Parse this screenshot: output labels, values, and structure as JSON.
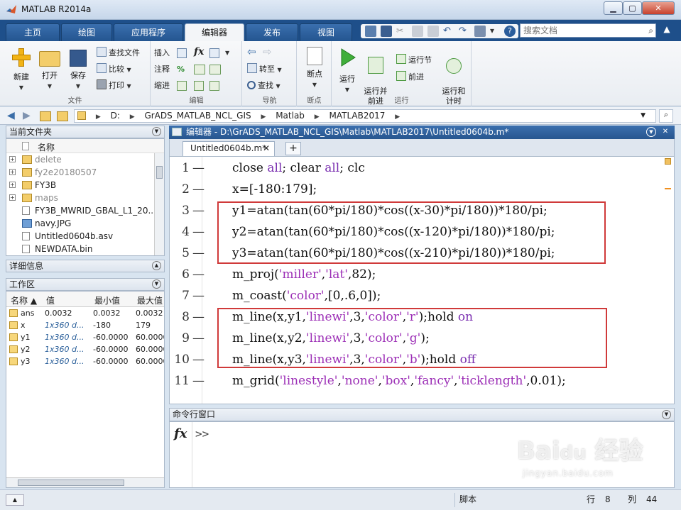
{
  "window": {
    "title": "MATLAB R2014a"
  },
  "ribbon_tabs": [
    {
      "label": "主页"
    },
    {
      "label": "绘图"
    },
    {
      "label": "应用程序"
    },
    {
      "label": "编辑器"
    },
    {
      "label": "发布"
    },
    {
      "label": "视图"
    }
  ],
  "search": {
    "placeholder": "搜索文档"
  },
  "ribbon": {
    "file": {
      "group_label": "文件",
      "new": "新建",
      "open": "打开",
      "save": "保存",
      "find_files": "查找文件",
      "compare": "比较",
      "print": "打印"
    },
    "edit": {
      "group_label": "编辑",
      "insert": "插入",
      "comment": "注释",
      "indent": "缩进",
      "fx": "fx",
      "percent": "%"
    },
    "navigate": {
      "group_label": "导航",
      "goto": "转至",
      "find": "查找"
    },
    "breakpoints": {
      "group_label": "断点",
      "breakpoints": "断点"
    },
    "run": {
      "group_label": "运行",
      "run": "运行",
      "run_advance": "运行并\n前进",
      "run_section": "运行节",
      "advance": "前进",
      "run_time": "运行和\n计时"
    }
  },
  "address": {
    "segments": [
      "D:",
      "GrADS_MATLAB_NCL_GIS",
      "Matlab",
      "MATLAB2017"
    ]
  },
  "current_folder": {
    "title": "当前文件夹",
    "column_name": "名称",
    "items": [
      {
        "name": "delete",
        "type": "folder",
        "dim": true
      },
      {
        "name": "fy2e20180507",
        "type": "folder",
        "dim": true
      },
      {
        "name": "FY3B",
        "type": "folder",
        "dim": false
      },
      {
        "name": "maps",
        "type": "folder",
        "dim": true
      },
      {
        "name": "FY3B_MWRID_GBAL_L1_20...",
        "type": "file",
        "dim": false
      },
      {
        "name": "navy.JPG",
        "type": "image",
        "dim": false
      },
      {
        "name": "Untitled0604b.asv",
        "type": "file",
        "dim": false
      },
      {
        "name": "NEWDATA.bin",
        "type": "file",
        "dim": false
      }
    ]
  },
  "details": {
    "title": "详细信息"
  },
  "workspace": {
    "title": "工作区",
    "columns": [
      "名称 ▲",
      "值",
      "最小值",
      "最大值"
    ],
    "rows": [
      {
        "name": "ans",
        "value": "0.0032",
        "min": "0.0032",
        "max": "0.0032",
        "italic": false
      },
      {
        "name": "x",
        "value": "1x360 d...",
        "min": "-180",
        "max": "179",
        "italic": true
      },
      {
        "name": "y1",
        "value": "1x360 d...",
        "min": "-60.0000",
        "max": "60.0000",
        "italic": true
      },
      {
        "name": "y2",
        "value": "1x360 d...",
        "min": "-60.0000",
        "max": "60.0000",
        "italic": true
      },
      {
        "name": "y3",
        "value": "1x360 d...",
        "min": "-60.0000",
        "max": "60.0000",
        "italic": true
      }
    ]
  },
  "editor": {
    "header": "编辑器 - D:\\GrADS_MATLAB_NCL_GIS\\Matlab\\MATLAB2017\\Untitled0604b.m*",
    "tab_name": "Untitled0604b.m*",
    "lines": [
      {
        "num": "1",
        "segs": [
          [
            "close ",
            ""
          ],
          [
            "all",
            "kw"
          ],
          [
            "; clear ",
            ""
          ],
          [
            "all",
            "kw"
          ],
          [
            "; clc",
            ""
          ]
        ]
      },
      {
        "num": "2",
        "segs": [
          [
            "x=[-180:179];",
            ""
          ]
        ]
      },
      {
        "num": "3",
        "segs": [
          [
            "y1=atan(tan(60*pi/180)*cos((x-30)*pi/180))*180/pi;",
            ""
          ]
        ]
      },
      {
        "num": "4",
        "segs": [
          [
            "y2=atan(tan(60*pi/180)*cos((x-120)*pi/180))*180/pi;",
            ""
          ]
        ]
      },
      {
        "num": "5",
        "segs": [
          [
            "y3=atan(tan(60*pi/180)*cos((x-210)*pi/180))*180/pi;",
            ""
          ]
        ]
      },
      {
        "num": "6",
        "segs": [
          [
            "m_proj(",
            ""
          ],
          [
            "'miller'",
            "str"
          ],
          [
            ",",
            ""
          ],
          [
            "'lat'",
            "str"
          ],
          [
            ",82);",
            ""
          ]
        ]
      },
      {
        "num": "7",
        "segs": [
          [
            "m_coast(",
            ""
          ],
          [
            "'color'",
            "str"
          ],
          [
            ",[0,.6,0]);",
            ""
          ]
        ]
      },
      {
        "num": "8",
        "segs": [
          [
            "m_line(x,y1,",
            ""
          ],
          [
            "'linewi'",
            "str"
          ],
          [
            ",3,",
            ""
          ],
          [
            "'color'",
            "str"
          ],
          [
            ",",
            ""
          ],
          [
            "'r'",
            "str"
          ],
          [
            ");hold ",
            ""
          ],
          [
            "on",
            "kw"
          ]
        ]
      },
      {
        "num": "9",
        "segs": [
          [
            "m_line(x,y2,",
            ""
          ],
          [
            "'linewi'",
            "str"
          ],
          [
            ",3,",
            ""
          ],
          [
            "'color'",
            "str"
          ],
          [
            ",",
            ""
          ],
          [
            "'g'",
            "str"
          ],
          [
            ");",
            ""
          ]
        ]
      },
      {
        "num": "10",
        "segs": [
          [
            "m_line(x,y3,",
            ""
          ],
          [
            "'linewi'",
            "str"
          ],
          [
            ",3,",
            ""
          ],
          [
            "'color'",
            "str"
          ],
          [
            ",",
            ""
          ],
          [
            "'b'",
            "str"
          ],
          [
            ");hold ",
            ""
          ],
          [
            "off",
            "kw"
          ]
        ]
      },
      {
        "num": "11",
        "segs": [
          [
            "m_grid(",
            ""
          ],
          [
            "'linestyle'",
            "str"
          ],
          [
            ",",
            ""
          ],
          [
            "'none'",
            "str"
          ],
          [
            ",",
            ""
          ],
          [
            "'box'",
            "str"
          ],
          [
            ",",
            ""
          ],
          [
            "'fancy'",
            "str"
          ],
          [
            ",",
            ""
          ],
          [
            "'ticklength'",
            "str"
          ],
          [
            ",0.01);",
            ""
          ]
        ]
      }
    ]
  },
  "command_window": {
    "title": "命令行窗口",
    "fx": "fx",
    "prompt": ">>"
  },
  "status": {
    "mode": "脚本",
    "row_label": "行",
    "row": "8",
    "col_label": "列",
    "col": "44"
  },
  "colors": {
    "ribbon_tab_bg": "#1e4f8a",
    "highlight_box": "#d03a3a",
    "keyword": "#7a2fb0",
    "string": "#9c2fb6"
  }
}
